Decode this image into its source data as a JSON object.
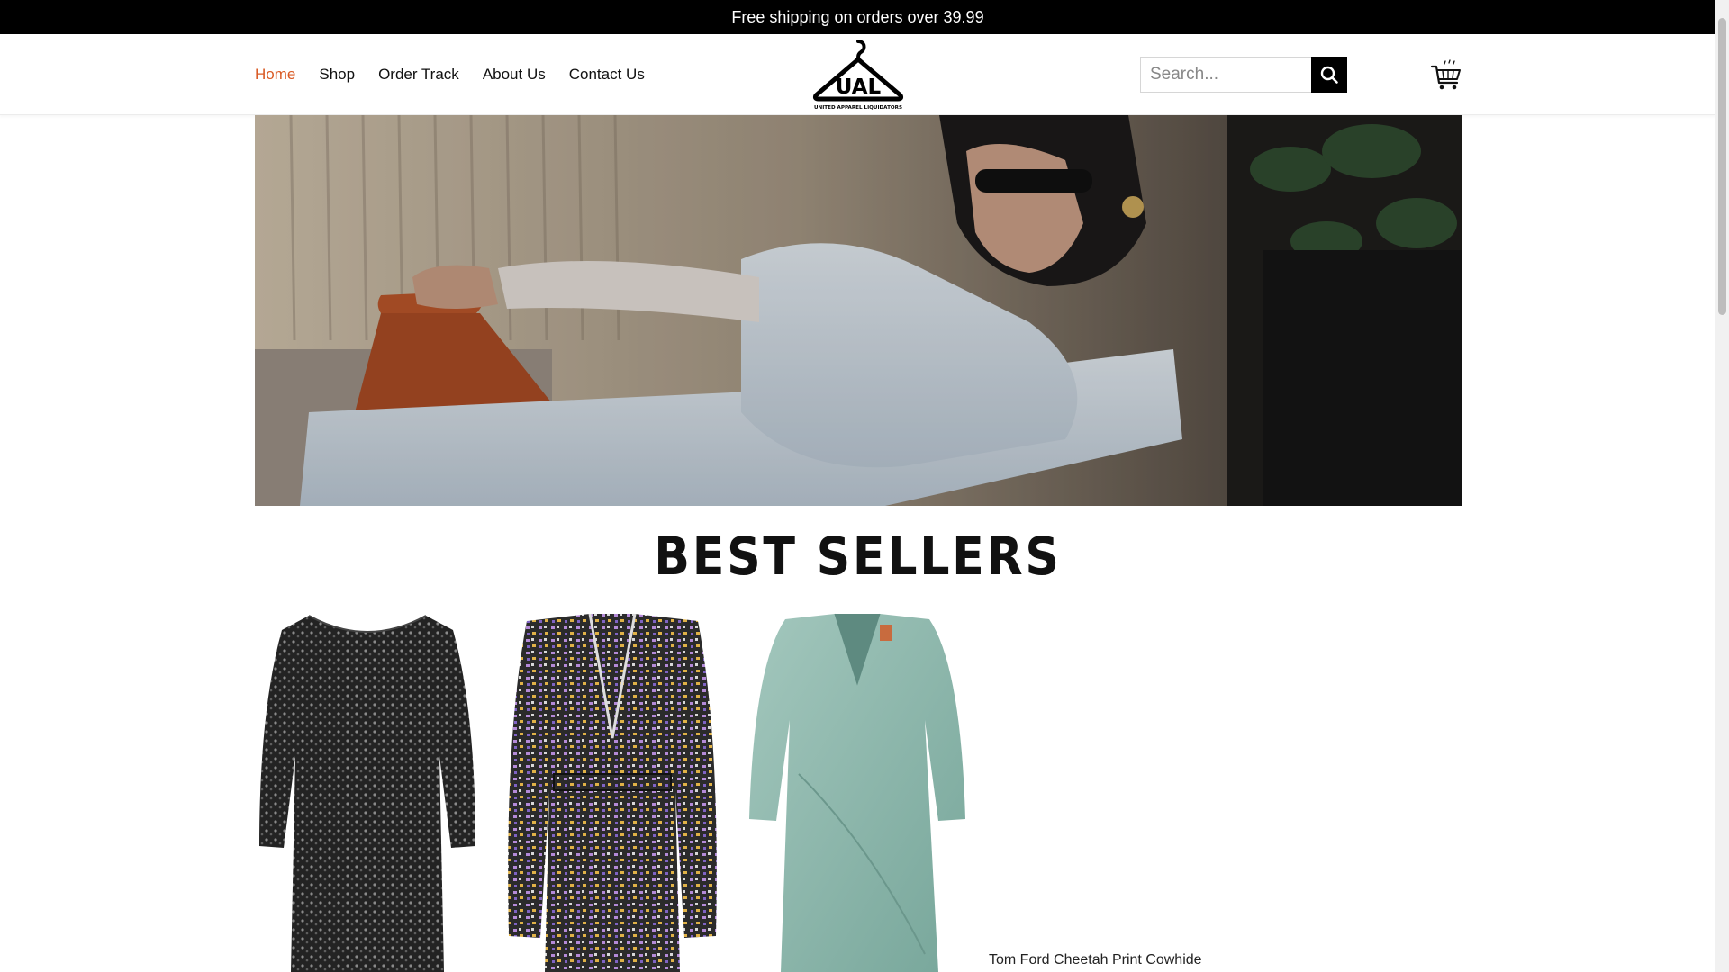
{
  "announcement": "Free shipping on orders over 39.99",
  "nav": {
    "items": [
      {
        "label": "Home",
        "active": true
      },
      {
        "label": "Shop"
      },
      {
        "label": "Order Track"
      },
      {
        "label": "About Us"
      },
      {
        "label": "Contact Us"
      }
    ]
  },
  "logo": {
    "letters": "UAL",
    "tagline": "UNITED APPAREL LIQUIDATORS"
  },
  "search": {
    "placeholder": "Search...",
    "icon": "search-icon"
  },
  "cart": {
    "icon": "cart-icon"
  },
  "section": {
    "title": "BEST SELLERS"
  },
  "products": [
    {
      "image": "black sequin dress"
    },
    {
      "image": "multicolor knit wrap cardigan"
    },
    {
      "image": "mint green dress"
    },
    {
      "title": "Tom Ford Cheetah Print Cowhide"
    }
  ],
  "colors": {
    "accent": "#d95a24",
    "topbar": "#000000"
  }
}
